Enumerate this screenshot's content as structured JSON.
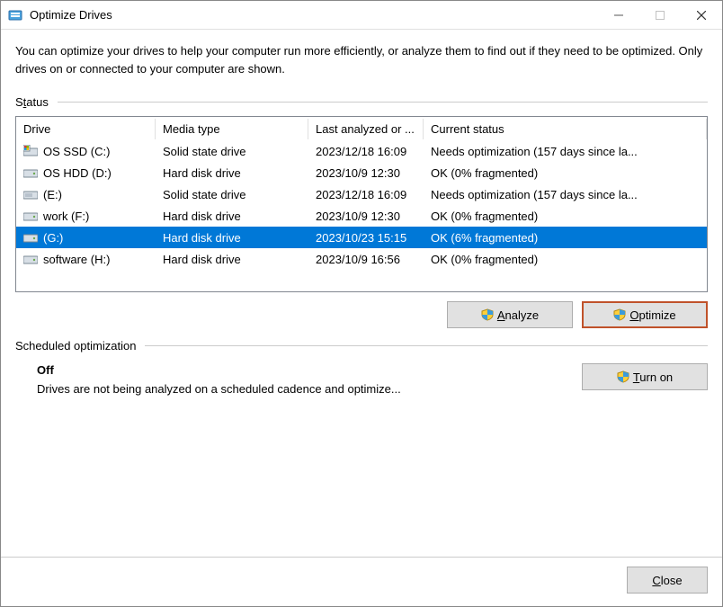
{
  "window": {
    "title": "Optimize Drives"
  },
  "description": "You can optimize your drives to help your computer run more efficiently, or analyze them to find out if they need to be optimized. Only drives on or connected to your computer are shown.",
  "status": {
    "label_pre": "S",
    "label_u": "t",
    "label_post": "atus",
    "columns": {
      "drive": "Drive",
      "media": "Media type",
      "last": "Last analyzed or ...",
      "status": "Current status"
    },
    "drives": [
      {
        "icon": "ssd-sys",
        "name": "OS SSD (C:)",
        "media": "Solid state drive",
        "last": "2023/12/18 16:09",
        "status": "Needs optimization (157 days since la...",
        "selected": false
      },
      {
        "icon": "hdd",
        "name": "OS HDD (D:)",
        "media": "Hard disk drive",
        "last": "2023/10/9 12:30",
        "status": "OK (0% fragmented)",
        "selected": false
      },
      {
        "icon": "ssd",
        "name": "(E:)",
        "media": "Solid state drive",
        "last": "2023/12/18 16:09",
        "status": "Needs optimization (157 days since la...",
        "selected": false
      },
      {
        "icon": "hdd",
        "name": "work (F:)",
        "media": "Hard disk drive",
        "last": "2023/10/9 12:30",
        "status": "OK (0% fragmented)",
        "selected": false
      },
      {
        "icon": "hdd",
        "name": "(G:)",
        "media": "Hard disk drive",
        "last": "2023/10/23 15:15",
        "status": "OK (6% fragmented)",
        "selected": true
      },
      {
        "icon": "hdd",
        "name": "software (H:)",
        "media": "Hard disk drive",
        "last": "2023/10/9 16:56",
        "status": "OK (0% fragmented)",
        "selected": false
      }
    ]
  },
  "buttons": {
    "analyze_u": "A",
    "analyze_post": "nalyze",
    "optimize_u": "O",
    "optimize_post": "ptimize",
    "turnon_u": "T",
    "turnon_post": "urn on",
    "close_u": "C",
    "close_post": "lose"
  },
  "schedule": {
    "label": "Scheduled optimization",
    "state": "Off",
    "description": "Drives are not being analyzed on a scheduled cadence and optimize..."
  }
}
